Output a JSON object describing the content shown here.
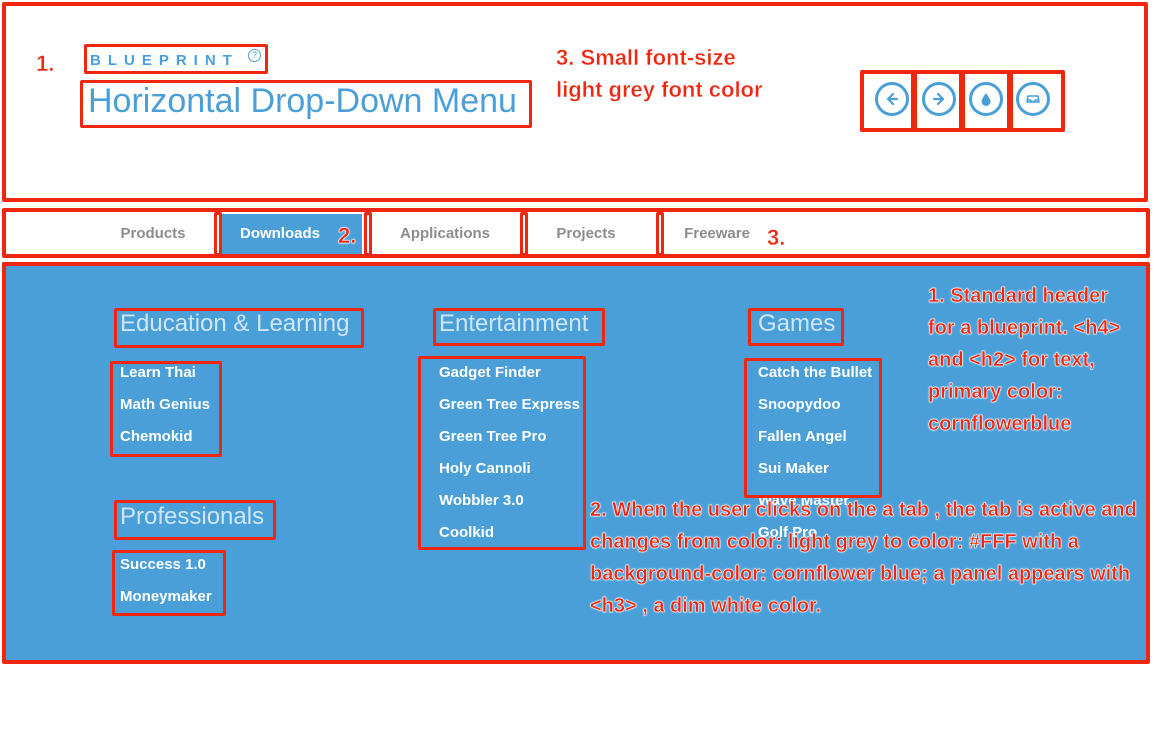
{
  "header": {
    "eyebrow": "BLUEPRINT",
    "help_glyph": "?",
    "title": "Horizontal Drop-Down Menu",
    "nav_icons": [
      "arrow-left-icon",
      "arrow-right-icon",
      "drop-icon",
      "inbox-icon"
    ]
  },
  "tabs": [
    {
      "label": "Products",
      "active": false
    },
    {
      "label": "Downloads",
      "active": true
    },
    {
      "label": "Applications",
      "active": false
    },
    {
      "label": "Projects",
      "active": false
    },
    {
      "label": "Freeware",
      "active": false
    }
  ],
  "panel": {
    "columns": [
      {
        "groups": [
          {
            "title": "Education & Learning",
            "items": [
              "Learn Thai",
              "Math Genius",
              "Chemokid"
            ]
          },
          {
            "title": "Professionals",
            "items": [
              "Success 1.0",
              "Moneymaker"
            ]
          }
        ]
      },
      {
        "groups": [
          {
            "title": "Entertainment",
            "items": [
              "Gadget Finder",
              "Green Tree Express",
              "Green Tree Pro",
              "Holy Cannoli",
              "Wobbler 3.0",
              "Coolkid"
            ]
          }
        ]
      },
      {
        "groups": [
          {
            "title": "Games",
            "items": [
              "Catch the Bullet",
              "Snoopydoo",
              "Fallen Angel",
              "Sui Maker",
              "Wave Master",
              "Golf Pro"
            ]
          }
        ]
      }
    ]
  },
  "annotations": {
    "marker_1": "1.",
    "marker_3_header": "3. Small font-size light grey font color",
    "marker_2_tab": "2.",
    "marker_3_tab": "3.",
    "note_1": "1. Standard header for a blueprint. <h4> and <h2> for text, primary color: cornflowerblue",
    "note_2": "2. When the user clicks on the a tab , the tab is active and changes from color: light grey to color: #FFF with a background-color: cornflower blue; a panel appears with <h3> , a dim white color."
  },
  "colors": {
    "primary": "#4a9fd8",
    "annotation_red": "#f0260f",
    "tab_inactive": "#8c8c8c",
    "panel_heading": "#cfe6f7"
  }
}
